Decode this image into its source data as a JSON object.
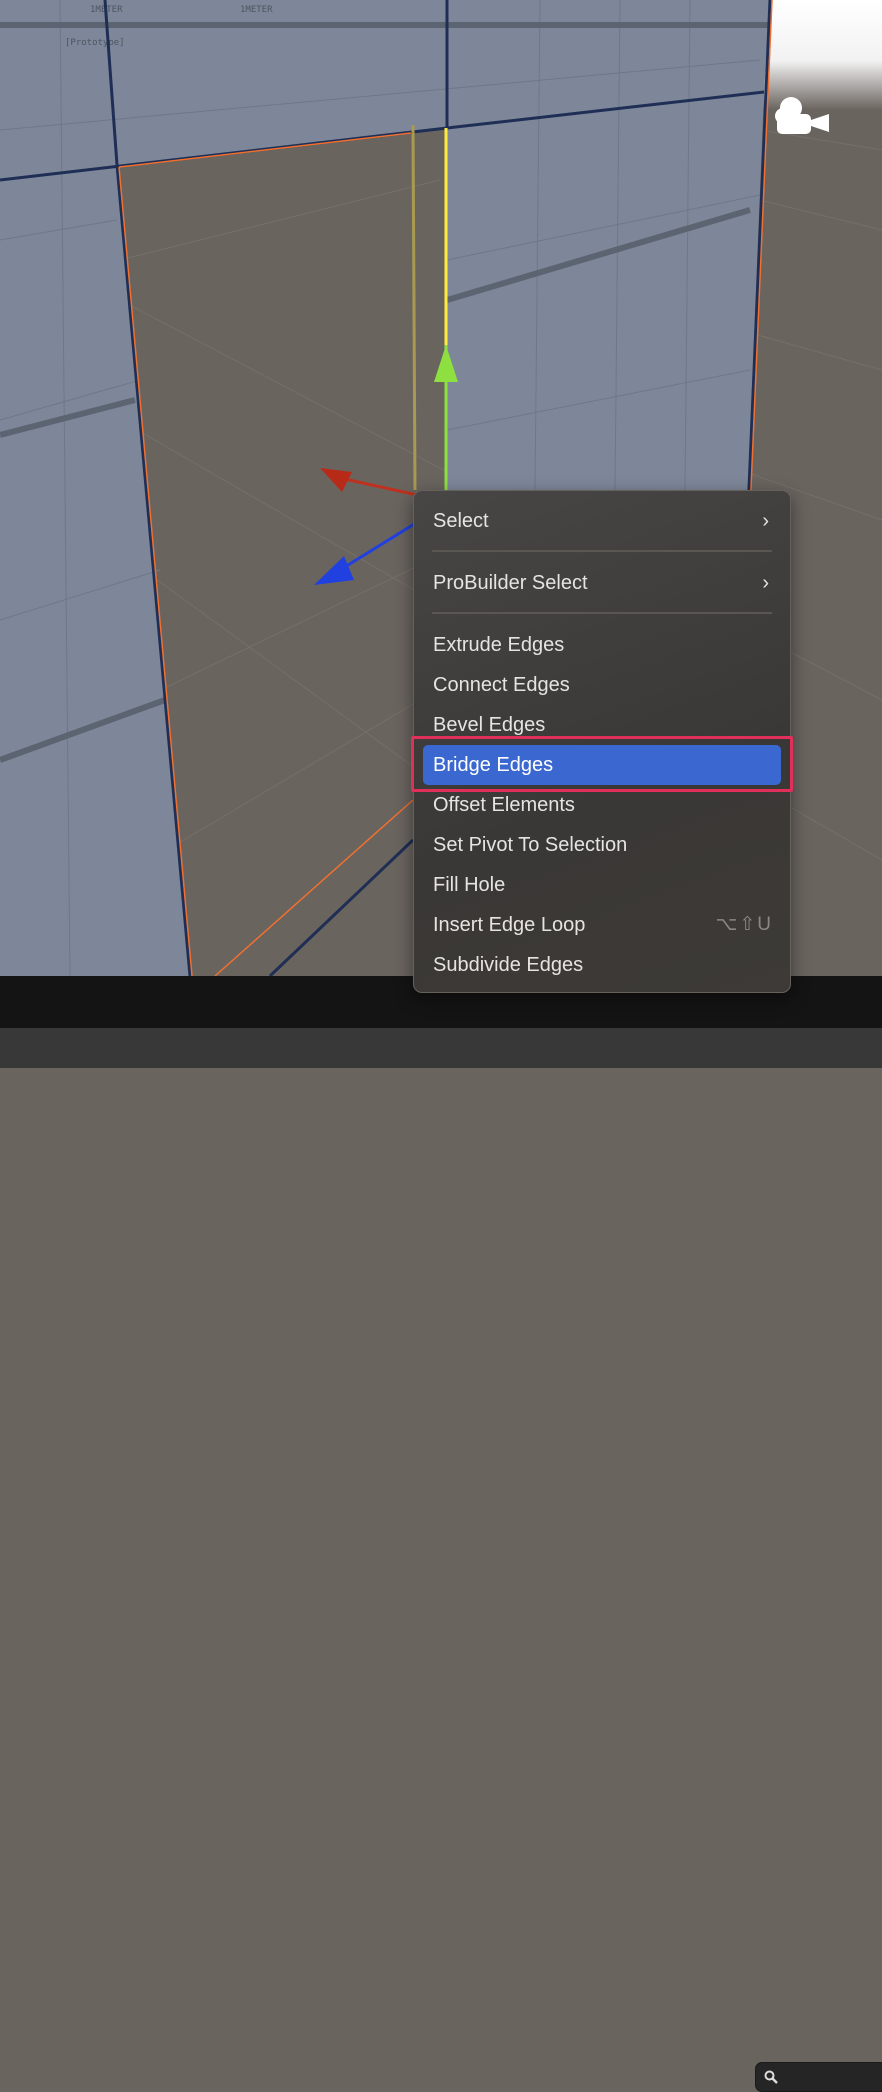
{
  "scene": {
    "texture_labels": [
      "1METER",
      "[Prototype]"
    ],
    "colors": {
      "wall": "#7d8799",
      "floor": "#6a645f",
      "edge_selected": "#f07030",
      "edge": "#1f2e55",
      "axis_x": "#c0301e",
      "axis_y": "#8ee040",
      "axis_z": "#2040e0",
      "highlight": "#3a68d0",
      "outline": "#e0305a"
    },
    "camera_icon": "camera-icon"
  },
  "context_menu": {
    "items": [
      {
        "label": "Select",
        "submenu": true
      },
      {
        "label": "ProBuilder Select",
        "submenu": true
      },
      {
        "label": "Extrude Edges"
      },
      {
        "label": "Connect Edges"
      },
      {
        "label": "Bevel Edges"
      },
      {
        "label": "Bridge Edges",
        "highlighted": true
      },
      {
        "label": "Offset Elements"
      },
      {
        "label": "Set Pivot To Selection"
      },
      {
        "label": "Fill Hole"
      },
      {
        "label": "Insert Edge Loop",
        "shortcut": "⌥⇧U"
      },
      {
        "label": "Subdivide Edges"
      }
    ],
    "chevron": "›"
  },
  "statusbar": {
    "search_icon": "search-icon"
  }
}
